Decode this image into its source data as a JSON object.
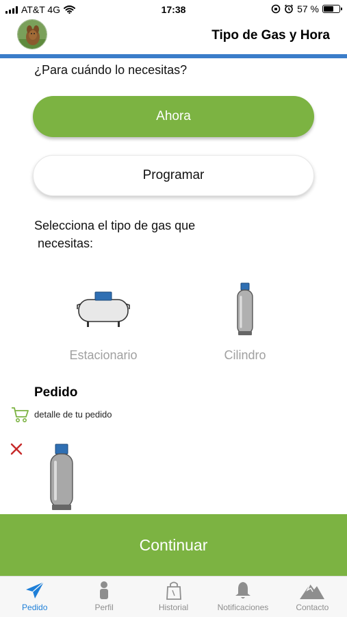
{
  "status_bar": {
    "carrier": "AT&T 4G",
    "time": "17:38",
    "battery": "57 %",
    "battery_level": 0.57
  },
  "header": {
    "title": "Tipo de Gas y Hora"
  },
  "schedule": {
    "question": "¿Para cuándo lo necesitas?",
    "now_label": "Ahora",
    "schedule_label": "Programar"
  },
  "gas_type": {
    "question_line1": "Selecciona el tipo de gas que",
    "question_line2": "necesitas:",
    "options": [
      {
        "label": "Estacionario",
        "icon": "stationary-tank-icon"
      },
      {
        "label": "Cilindro",
        "icon": "gas-cylinder-icon"
      }
    ]
  },
  "order": {
    "title": "Pedido",
    "detail": "detalle de tu pedido",
    "item_icon": "gas-cylinder-icon"
  },
  "continue_label": "Continuar",
  "tabs": [
    {
      "label": "Pedido",
      "icon": "paper-plane-icon",
      "active": true
    },
    {
      "label": "Perfil",
      "icon": "person-icon",
      "active": false
    },
    {
      "label": "Historial",
      "icon": "shopping-bag-icon",
      "active": false
    },
    {
      "label": "Notificaciones",
      "icon": "bell-icon",
      "active": false
    },
    {
      "label": "Contacto",
      "icon": "mountain-icon",
      "active": false
    }
  ],
  "colors": {
    "accent_green": "#7cb342",
    "header_rule_blue": "#3b7dc9",
    "active_tab_blue": "#1e7fd8",
    "remove_red": "#c62828",
    "tank_cap_blue": "#2f6fb3"
  }
}
